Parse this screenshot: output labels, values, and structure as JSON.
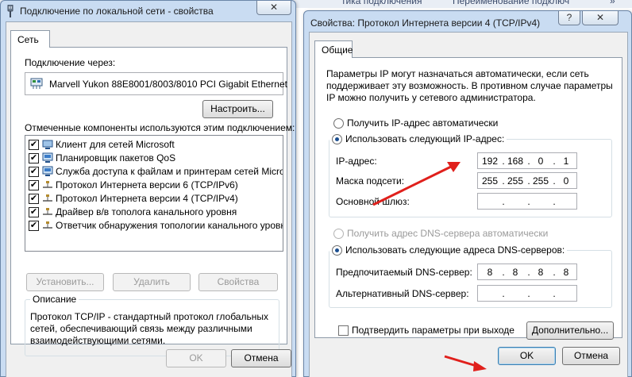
{
  "background": {
    "fragments": [
      "тика подключения",
      "Переименование подключ",
      "»"
    ]
  },
  "left_window": {
    "title": "Подключение по локальной сети - свойства",
    "close_label": "✕",
    "tab_network": "Сеть",
    "connect_via_label": "Подключение через:",
    "adapter_name": "Marvell Yukon 88E8001/8003/8010 PCI Gigabit Ethernet",
    "configure_button": "Настроить...",
    "components_label": "Отмеченные компоненты используются этим подключением:",
    "components": [
      {
        "label": "Клиент для сетей Microsoft",
        "checked": true,
        "icon": "network-client-icon"
      },
      {
        "label": "Планировщик пакетов QoS",
        "checked": true,
        "icon": "network-service-icon"
      },
      {
        "label": "Служба доступа к файлам и принтерам сетей Micro...",
        "checked": true,
        "icon": "network-service-icon"
      },
      {
        "label": "Протокол Интернета версии 6 (TCP/IPv6)",
        "checked": true,
        "icon": "protocol-icon"
      },
      {
        "label": "Протокол Интернета версии 4 (TCP/IPv4)",
        "checked": true,
        "icon": "protocol-icon"
      },
      {
        "label": "Драйвер в/в тополога канального уровня",
        "checked": true,
        "icon": "protocol-icon"
      },
      {
        "label": "Ответчик обнаружения топологии канального уровня",
        "checked": true,
        "icon": "protocol-icon"
      }
    ],
    "install_button": "Установить...",
    "remove_button": "Удалить",
    "properties_button": "Свойства",
    "description_title": "Описание",
    "description_text_1": "Протокол TCP/IP - стандартный протокол глобальных",
    "description_text_2": "сетей, обеспечивающий связь между различными",
    "description_text_3": "взаимодействующими сетями.",
    "ok_button": "OK",
    "cancel_button": "Отмена"
  },
  "right_window": {
    "title": "Свойства: Протокол Интернета версии 4 (TCP/IPv4)",
    "help_label": "?",
    "close_label": "✕",
    "tab_general": "Общие",
    "info_line_1": "Параметры IP могут назначаться автоматически, если сеть",
    "info_line_2": "поддерживает эту возможность. В противном случае параметры",
    "info_line_3": "IP можно получить у сетевого администратора.",
    "radio_ip_auto": "Получить IP-адрес автоматически",
    "radio_ip_manual": "Использовать следующий IP-адрес:",
    "ip_mode_selected": "manual",
    "ip_address_label": "IP-адрес:",
    "ip_address": [
      "192",
      "168",
      "0",
      "1"
    ],
    "subnet_label": "Маска подсети:",
    "subnet_mask": [
      "255",
      "255",
      "255",
      "0"
    ],
    "gateway_label": "Основной шлюз:",
    "gateway": [
      "",
      "",
      "",
      ""
    ],
    "radio_dns_auto": "Получить адрес DNS-сервера автоматически",
    "radio_dns_manual": "Использовать следующие адреса DNS-серверов:",
    "dns_mode_selected": "manual",
    "preferred_dns_label": "Предпочитаемый DNS-сервер:",
    "preferred_dns": [
      "8",
      "8",
      "8",
      "8"
    ],
    "alternate_dns_label": "Альтернативный DNS-сервер:",
    "alternate_dns": [
      "",
      "",
      "",
      ""
    ],
    "validate_on_exit_label": "Подтвердить параметры при выходе",
    "validate_on_exit_checked": false,
    "advanced_button": "Дополнительно...",
    "ok_button": "OK",
    "cancel_button": "Отмена"
  },
  "annotations": {
    "arrow_color": "#e0201c",
    "arrows": [
      "arrow-to-ip-fields",
      "arrow-to-ok-button"
    ]
  }
}
